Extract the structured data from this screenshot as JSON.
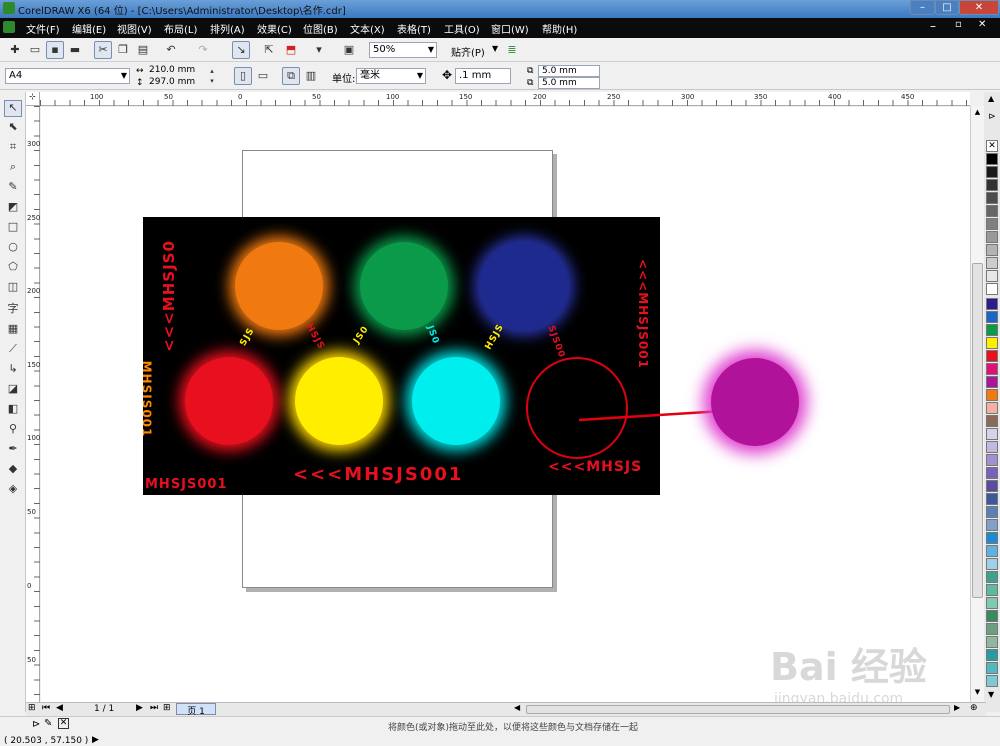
{
  "window": {
    "title": "CorelDRAW X6 (64 位) - [C:\\Users\\Administrator\\Desktop\\名作.cdr]"
  },
  "menu": [
    "文件(F)",
    "编辑(E)",
    "视图(V)",
    "布局(L)",
    "排列(A)",
    "效果(C)",
    "位图(B)",
    "文本(X)",
    "表格(T)",
    "工具(O)",
    "窗口(W)",
    "帮助(H)"
  ],
  "toolbar": {
    "zoom": "50%",
    "snap": "贴齐(P)"
  },
  "propertybar": {
    "page_size": "A4",
    "width": "210.0 mm",
    "height": "297.0 mm",
    "unit_label": "单位:",
    "unit": "毫米",
    "nudge": ".1 mm",
    "dup_x": "5.0 mm",
    "dup_y": "5.0 mm"
  },
  "ruler_top": [
    "100",
    "50",
    "0",
    "50",
    "100",
    "150",
    "200",
    "250",
    "300",
    "350",
    "400",
    "450"
  ],
  "ruler_left": [
    "300",
    "250",
    "200",
    "150",
    "100",
    "50",
    "0",
    "50"
  ],
  "poster": {
    "left_vertical_text": "<<<MHSJS0",
    "right_vertical_text": "<<<MHSJS001",
    "bottom_text": "<<<MHSJS001",
    "bottom_left_text": "MHSJS001",
    "bottom_right_text": "<<<MHSJS",
    "left_edge_text": "MHSJS001"
  },
  "colors": {
    "orange": "#f07a10",
    "green": "#0a9a4a",
    "navy": "#1e2a8e",
    "red": "#e8101e",
    "yellow": "#ffee00",
    "cyan": "#00eeee",
    "magenta": "#b0129a",
    "annotation": "#e00010"
  },
  "pagebar": {
    "page_count": "1 / 1",
    "page_tab": "页 1"
  },
  "status": {
    "coords": "( 20.503 , 57.150 )",
    "hint": "将颜色(或对象)拖动至此处，以便将这些颜色与文档存储在一起"
  },
  "watermark": {
    "brand": "Bai 经验",
    "url": "jingyan.baidu.com"
  }
}
